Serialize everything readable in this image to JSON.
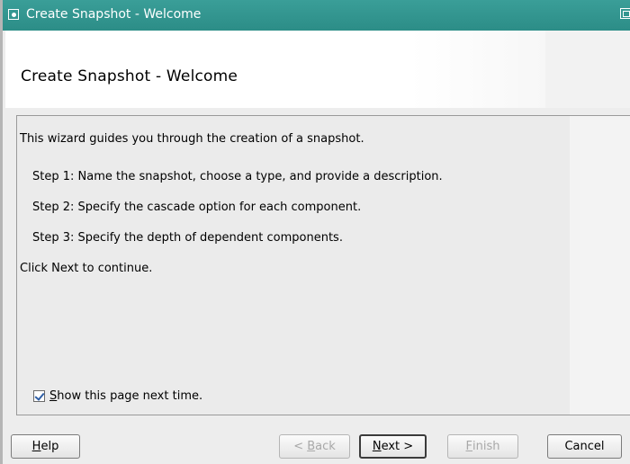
{
  "window": {
    "title": "Create Snapshot - Welcome"
  },
  "header": {
    "title": "Create Snapshot - Welcome"
  },
  "content": {
    "intro": "This wizard guides you through the creation of a snapshot.",
    "steps": [
      "Step 1: Name the snapshot, choose a type, and provide a description.",
      "Step 2: Specify the cascade option for each component.",
      "Step 3: Specify the depth of dependent components."
    ],
    "outro": "Click Next to continue.",
    "checkbox": {
      "mnemonic": "S",
      "rest": "how this page next time.",
      "checked": true
    }
  },
  "buttons": {
    "help": {
      "mnemonic": "H",
      "rest": "elp"
    },
    "back": {
      "prefix": "< ",
      "mnemonic": "B",
      "rest": "ack"
    },
    "next": {
      "mnemonic": "N",
      "rest": "ext >"
    },
    "finish": {
      "mnemonic": "F",
      "rest": "inish"
    },
    "cancel": {
      "label": "Cancel"
    }
  },
  "colors": {
    "titlebar": "#2c8d87",
    "check": "#2f5fa6"
  }
}
